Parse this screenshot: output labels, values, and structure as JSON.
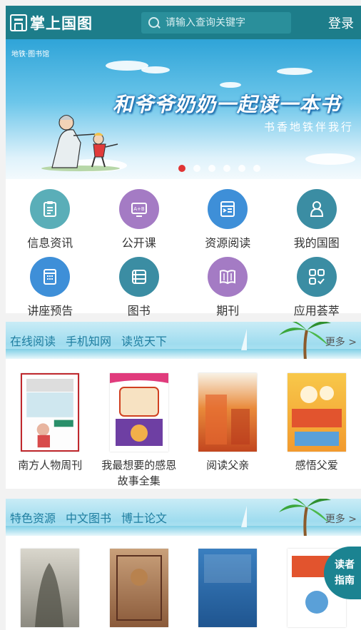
{
  "header": {
    "logo_text": "掌上国图",
    "search_placeholder": "请输入查询关键字",
    "login_label": "登录"
  },
  "banner": {
    "brand": "地铁·图书馆",
    "title": "和爷爷奶奶一起读一本书",
    "subtitle": "书香地铁伴我行",
    "slide_count": 6,
    "active_slide": 1
  },
  "nav_grid": [
    {
      "label": "信息资讯",
      "icon": "clipboard-icon",
      "color": "#5aaeb8"
    },
    {
      "label": "公开课",
      "icon": "blackboard-icon",
      "color": "#a47bc4"
    },
    {
      "label": "资源阅读",
      "icon": "document-arrow-icon",
      "color": "#3e8fd8"
    },
    {
      "label": "我的国图",
      "icon": "user-icon",
      "color": "#3b8da3"
    },
    {
      "label": "讲座预告",
      "icon": "calendar-icon",
      "color": "#3e8fd8"
    },
    {
      "label": "图书",
      "icon": "books-icon",
      "color": "#3b8da3"
    },
    {
      "label": "期刊",
      "icon": "open-book-icon",
      "color": "#a47bc4"
    },
    {
      "label": "应用荟萃",
      "icon": "apps-icon",
      "color": "#3b8da3"
    }
  ],
  "section1": {
    "links": [
      "在线阅读",
      "手机知网",
      "读览天下"
    ],
    "more_label": "更多 >"
  },
  "books1": [
    {
      "title": "南方人物周刊"
    },
    {
      "title": "我最想要的感恩故事全集"
    },
    {
      "title": "阅读父亲"
    },
    {
      "title": "感悟父爱"
    }
  ],
  "section2": {
    "links": [
      "特色资源",
      "中文图书",
      "博士论文"
    ],
    "more_label": "更多 >"
  },
  "float_button": {
    "line1": "读者",
    "line2": "指南"
  }
}
